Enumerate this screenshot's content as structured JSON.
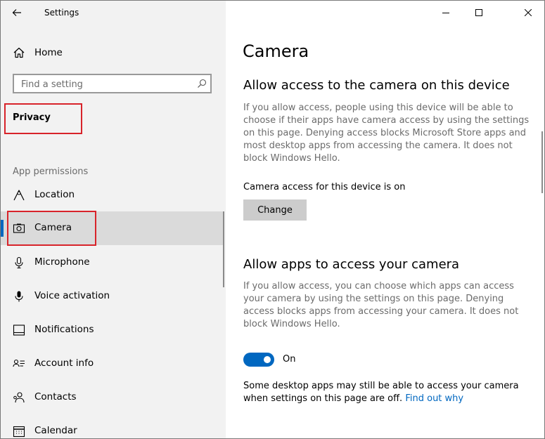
{
  "window": {
    "title": "Settings"
  },
  "sidebar": {
    "home_label": "Home",
    "search_placeholder": "Find a setting",
    "section_title": "Privacy",
    "group_label": "App permissions",
    "items": [
      {
        "label": "Location",
        "icon": "location-icon"
      },
      {
        "label": "Camera",
        "icon": "camera-icon",
        "selected": true
      },
      {
        "label": "Microphone",
        "icon": "microphone-icon"
      },
      {
        "label": "Voice activation",
        "icon": "voice-activation-icon"
      },
      {
        "label": "Notifications",
        "icon": "notifications-icon"
      },
      {
        "label": "Account info",
        "icon": "account-info-icon"
      },
      {
        "label": "Contacts",
        "icon": "contacts-icon"
      },
      {
        "label": "Calendar",
        "icon": "calendar-icon"
      }
    ]
  },
  "main": {
    "page_title": "Camera",
    "device_section": {
      "heading": "Allow access to the camera on this device",
      "description": "If you allow access, people using this device will be able to choose if their apps have camera access by using the settings on this page. Denying access blocks Microsoft Store apps and most desktop apps from accessing the camera. It does not block Windows Hello.",
      "status": "Camera access for this device is on",
      "change_label": "Change"
    },
    "apps_section": {
      "heading": "Allow apps to access your camera",
      "description": "If you allow access, you can choose which apps can access your camera by using the settings on this page. Denying access blocks apps from accessing your camera. It does not block Windows Hello.",
      "toggle_state": "On",
      "note": "Some desktop apps may still be able to access your camera when settings on this page are off.",
      "link": "Find out why"
    }
  },
  "colors": {
    "accent": "#0067c0",
    "highlight": "#d8232a",
    "sidebar_bg": "#f2f2f2",
    "selected_bg": "#dadada"
  }
}
